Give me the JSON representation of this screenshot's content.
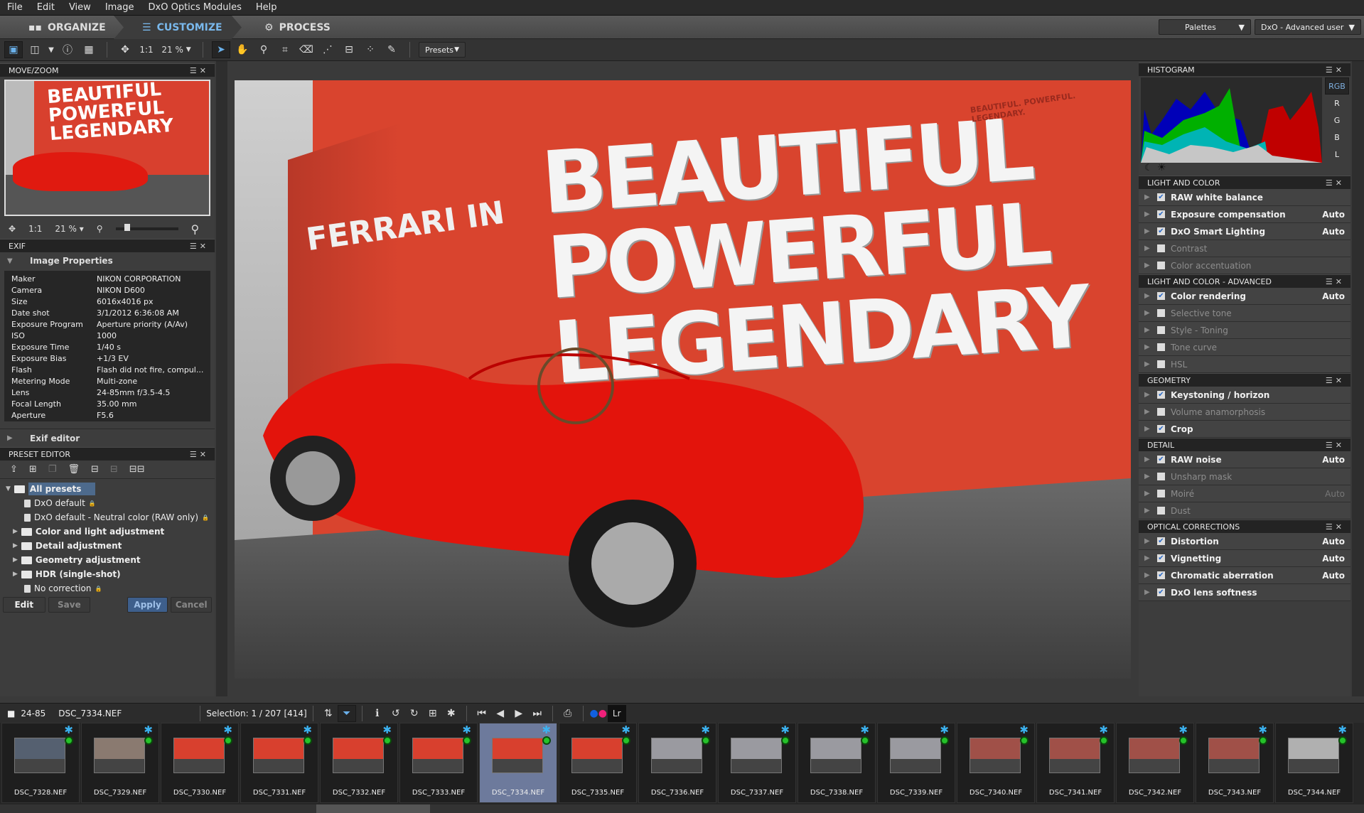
{
  "menu": [
    "File",
    "Edit",
    "View",
    "Image",
    "DxO Optics Modules",
    "Help"
  ],
  "modes": [
    {
      "label": "ORGANIZE",
      "icon": "grid-icon"
    },
    {
      "label": "CUSTOMIZE",
      "icon": "sliders-icon"
    },
    {
      "label": "PROCESS",
      "icon": "gears-icon"
    }
  ],
  "top_dropdowns": {
    "palettes": "Palettes",
    "workspace": "DxO - Advanced user"
  },
  "toolbar": {
    "one_to_one": "1:1",
    "zoom": "21 %",
    "presets": "Presets"
  },
  "left": {
    "movezoom": {
      "title": "MOVE/ZOOM",
      "one_to_one": "1:1",
      "zoom": "21 %",
      "slider_fraction": 0.15
    },
    "exif": {
      "title": "EXIF",
      "section": "Image Properties",
      "rows": [
        [
          "Maker",
          "NIKON CORPORATION"
        ],
        [
          "Camera",
          "NIKON D600"
        ],
        [
          "Size",
          "6016x4016 px"
        ],
        [
          "Date shot",
          "3/1/2012 6:36:08 AM"
        ],
        [
          "Exposure Program",
          "Aperture priority (A/Av)"
        ],
        [
          "ISO",
          "1000"
        ],
        [
          "Exposure Time",
          "1/40 s"
        ],
        [
          "Exposure Bias",
          "+1/3 EV"
        ],
        [
          "Flash",
          "Flash did not fire, compul..."
        ],
        [
          "Metering Mode",
          "Multi-zone"
        ],
        [
          "Lens",
          "24-85mm f/3.5-4.5"
        ],
        [
          "Focal Length",
          "35.00 mm"
        ],
        [
          "Aperture",
          "F5.6"
        ]
      ],
      "editor": "Exif editor"
    },
    "preset": {
      "title": "PRESET EDITOR",
      "tree": [
        {
          "label": "All presets",
          "type": "folder",
          "level": 0,
          "open": true,
          "selected": true
        },
        {
          "label": "DxO default",
          "type": "preset",
          "level": 1,
          "locked": true
        },
        {
          "label": "DxO default - Neutral color (RAW only)",
          "type": "preset",
          "level": 1,
          "locked": true
        },
        {
          "label": "Color and light adjustment",
          "type": "folder",
          "level": 1
        },
        {
          "label": "Detail adjustment",
          "type": "folder",
          "level": 1
        },
        {
          "label": "Geometry adjustment",
          "type": "folder",
          "level": 1
        },
        {
          "label": "HDR (single-shot)",
          "type": "folder",
          "level": 1
        },
        {
          "label": "No correction",
          "type": "preset",
          "level": 1,
          "locked": true
        }
      ],
      "buttons": {
        "edit": "Edit",
        "save": "Save",
        "apply": "Apply",
        "cancel": "Cancel"
      }
    }
  },
  "image": {
    "wall_text": [
      "BEAUTIFUL",
      "POWERFUL",
      "LEGENDARY"
    ],
    "side_text": "FERRARI IN",
    "small_heading": "BEAUTIFUL. POWERFUL. LEGENDARY."
  },
  "right": {
    "histogram": {
      "title": "HISTOGRAM",
      "channels": [
        "RGB",
        "R",
        "G",
        "B",
        "L"
      ],
      "active": "RGB"
    },
    "groups": [
      {
        "title": "LIGHT AND COLOR",
        "items": [
          {
            "label": "RAW white balance",
            "on": true,
            "auto": ""
          },
          {
            "label": "Exposure compensation",
            "on": true,
            "auto": "Auto"
          },
          {
            "label": "DxO Smart Lighting",
            "on": true,
            "auto": "Auto"
          },
          {
            "label": "Contrast",
            "on": false,
            "auto": ""
          },
          {
            "label": "Color accentuation",
            "on": false,
            "auto": ""
          }
        ]
      },
      {
        "title": "LIGHT AND COLOR - ADVANCED",
        "items": [
          {
            "label": "Color rendering",
            "on": true,
            "auto": "Auto"
          },
          {
            "label": "Selective tone",
            "on": false,
            "auto": ""
          },
          {
            "label": "Style - Toning",
            "on": false,
            "auto": ""
          },
          {
            "label": "Tone curve",
            "on": false,
            "auto": ""
          },
          {
            "label": "HSL",
            "on": false,
            "auto": ""
          }
        ]
      },
      {
        "title": "GEOMETRY",
        "items": [
          {
            "label": "Keystoning / horizon",
            "on": true,
            "auto": ""
          },
          {
            "label": "Volume anamorphosis",
            "on": false,
            "auto": ""
          },
          {
            "label": "Crop",
            "on": true,
            "auto": ""
          }
        ]
      },
      {
        "title": "DETAIL",
        "items": [
          {
            "label": "RAW noise",
            "on": true,
            "auto": "Auto"
          },
          {
            "label": "Unsharp mask",
            "on": false,
            "auto": ""
          },
          {
            "label": "Moiré",
            "on": false,
            "auto": "Auto"
          },
          {
            "label": "Dust",
            "on": false,
            "auto": ""
          }
        ]
      },
      {
        "title": "OPTICAL CORRECTIONS",
        "items": [
          {
            "label": "Distortion",
            "on": true,
            "auto": "Auto"
          },
          {
            "label": "Vignetting",
            "on": true,
            "auto": "Auto"
          },
          {
            "label": "Chromatic aberration",
            "on": true,
            "auto": "Auto"
          },
          {
            "label": "DxO lens softness",
            "on": true,
            "auto": ""
          }
        ]
      }
    ]
  },
  "bottom": {
    "folder": "24-85",
    "file": "DSC_7334.NEF",
    "selection": "Selection: 1 / 207 [414]"
  },
  "film": {
    "selected": "DSC_7334.NEF",
    "thumbs": [
      {
        "name": "DSC_7328.NEF",
        "color": "#556070"
      },
      {
        "name": "DSC_7329.NEF",
        "color": "#8a7a70"
      },
      {
        "name": "DSC_7330.NEF",
        "color": "#d8402e"
      },
      {
        "name": "DSC_7331.NEF",
        "color": "#d8402e"
      },
      {
        "name": "DSC_7332.NEF",
        "color": "#d8402e"
      },
      {
        "name": "DSC_7333.NEF",
        "color": "#d8402e"
      },
      {
        "name": "DSC_7334.NEF",
        "color": "#d8402e"
      },
      {
        "name": "DSC_7335.NEF",
        "color": "#d8402e"
      },
      {
        "name": "DSC_7336.NEF",
        "color": "#9a9aa0"
      },
      {
        "name": "DSC_7337.NEF",
        "color": "#9a9aa0"
      },
      {
        "name": "DSC_7338.NEF",
        "color": "#9a9aa0"
      },
      {
        "name": "DSC_7339.NEF",
        "color": "#9a9aa0"
      },
      {
        "name": "DSC_7340.NEF",
        "color": "#a05048"
      },
      {
        "name": "DSC_7341.NEF",
        "color": "#a05048"
      },
      {
        "name": "DSC_7342.NEF",
        "color": "#a05048"
      },
      {
        "name": "DSC_7343.NEF",
        "color": "#a05048"
      },
      {
        "name": "DSC_7344.NEF",
        "color": "#b0b0b0"
      }
    ]
  }
}
